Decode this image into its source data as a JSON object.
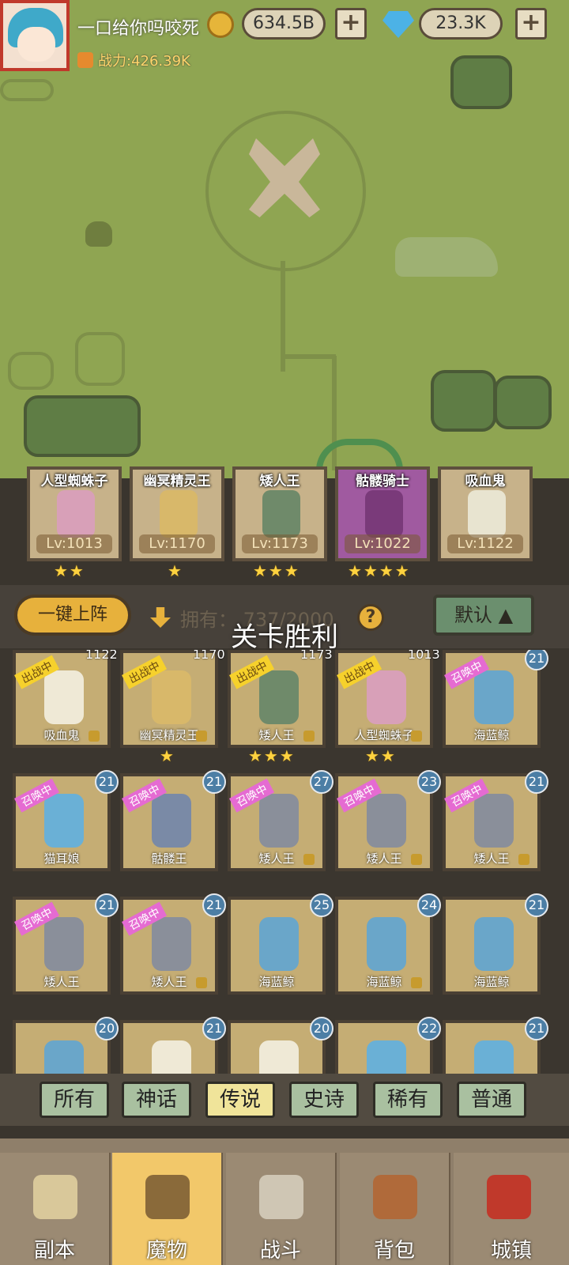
{
  "header": {
    "player_name": "一口给你吗咬死",
    "power": "战力:426.39K",
    "gold": "634.5B",
    "gems": "23.3K",
    "plus": "+"
  },
  "formation": [
    {
      "name": "人型蜘蛛子",
      "level": "Lv:1013",
      "stars": "★★"
    },
    {
      "name": "幽冥精灵王",
      "level": "Lv:1170",
      "stars": "★"
    },
    {
      "name": "矮人王",
      "level": "Lv:1173",
      "stars": "★★★"
    },
    {
      "name": "骷髅骑士",
      "level": "Lv:1022",
      "stars": "★★★★"
    },
    {
      "name": "吸血鬼",
      "level": "Lv:1122",
      "stars": ""
    }
  ],
  "toolbar": {
    "deploy": "一键上阵",
    "own": "拥有： 737/2000",
    "help": "?",
    "sort": "默认 ▲"
  },
  "toast": "关卡胜利",
  "cards": [
    {
      "name": "吸血鬼",
      "tag": "出战中",
      "badge": "",
      "lvtxt": "1122",
      "stars": ""
    },
    {
      "name": "幽冥精灵王",
      "tag": "出战中",
      "badge": "",
      "lvtxt": "1170",
      "stars": "★"
    },
    {
      "name": "矮人王",
      "tag": "出战中",
      "badge": "",
      "lvtxt": "1173",
      "stars": "★★★"
    },
    {
      "name": "人型蜘蛛子",
      "tag": "出战中",
      "badge": "",
      "lvtxt": "1013",
      "stars": "★★"
    },
    {
      "name": "海蓝鲸",
      "tag": "召唤中",
      "badge": "21",
      "lvtxt": "",
      "stars": ""
    },
    {
      "name": "猫耳娘",
      "tag": "召唤中",
      "badge": "21"
    },
    {
      "name": "骷髅王",
      "tag": "召唤中",
      "badge": "21"
    },
    {
      "name": "矮人王",
      "tag": "召唤中",
      "badge": "27"
    },
    {
      "name": "矮人王",
      "tag": "召唤中",
      "badge": "23"
    },
    {
      "name": "矮人王",
      "tag": "召唤中",
      "badge": "21"
    },
    {
      "name": "矮人王",
      "tag": "召唤中",
      "badge": "21"
    },
    {
      "name": "矮人王",
      "tag": "召唤中",
      "badge": "21"
    },
    {
      "name": "海蓝鲸",
      "tag": "",
      "badge": "25"
    },
    {
      "name": "海蓝鲸",
      "tag": "",
      "badge": "24"
    },
    {
      "name": "海蓝鲸",
      "tag": "",
      "badge": "21"
    },
    {
      "name": "",
      "tag": "",
      "badge": "20"
    },
    {
      "name": "",
      "tag": "",
      "badge": "21"
    },
    {
      "name": "",
      "tag": "",
      "badge": "20"
    },
    {
      "name": "",
      "tag": "",
      "badge": "22"
    },
    {
      "name": "",
      "tag": "",
      "badge": "21"
    }
  ],
  "filters": [
    "所有",
    "神话",
    "传说",
    "史诗",
    "稀有",
    "普通"
  ],
  "nav": [
    "副本",
    "魔物",
    "战斗",
    "背包",
    "城镇"
  ],
  "colors": {
    "map": "#8fa552",
    "accent": "#e7b13c",
    "summon_tag": "#e56bd2",
    "fight_tag": "#f6d12c"
  }
}
